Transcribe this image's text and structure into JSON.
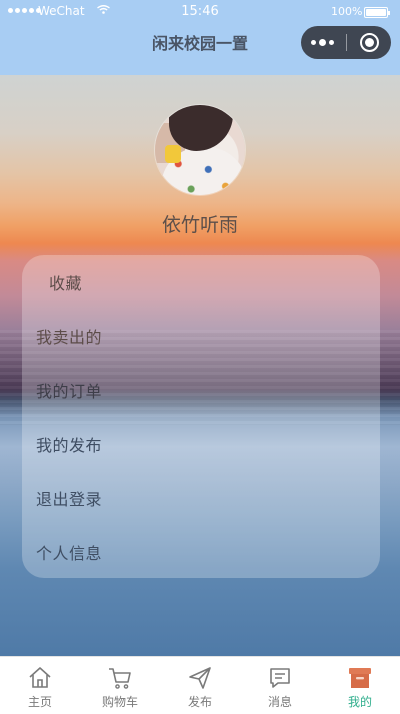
{
  "status_bar": {
    "carrier": "WeChat",
    "time": "15:46",
    "battery": "100%"
  },
  "nav": {
    "title": "闲来校园一置"
  },
  "profile": {
    "username": "依竹听雨"
  },
  "menu": {
    "items": [
      {
        "label": "收藏"
      },
      {
        "label": "我卖出的"
      },
      {
        "label": "我的订单"
      },
      {
        "label": "我的发布"
      },
      {
        "label": "退出登录"
      },
      {
        "label": "个人信息"
      }
    ]
  },
  "tabbar": {
    "active_color": "#2fae8c",
    "inactive_color": "#7a7a7a",
    "tabs": [
      {
        "label": "主页",
        "icon": "home-icon"
      },
      {
        "label": "购物车",
        "icon": "cart-icon"
      },
      {
        "label": "发布",
        "icon": "send-icon"
      },
      {
        "label": "消息",
        "icon": "message-icon"
      },
      {
        "label": "我的",
        "icon": "profile-box-icon",
        "active": true
      }
    ]
  }
}
